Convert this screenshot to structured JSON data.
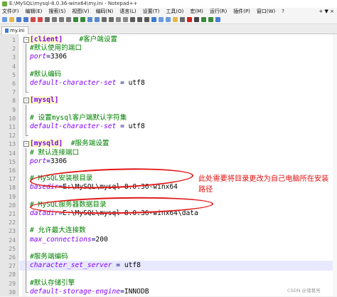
{
  "window": {
    "title": "E:\\MySQL\\mysql-8.0.36-winx64\\my.ini - Notepad++",
    "menu": [
      "文件(F)",
      "编辑(E)",
      "搜索(S)",
      "视图(V)",
      "编码(N)",
      "语言(L)",
      "设置(T)",
      "工具(O)",
      "宏(M)",
      "运行(R)",
      "插件(P)",
      "窗口(W)",
      "?"
    ],
    "menu_close": "+ ▼ ×"
  },
  "toolbar": {
    "icons": [
      "new-file-icon",
      "open-file-icon",
      "save-icon",
      "save-all-icon",
      "close-icon",
      "close-all-icon",
      "print-icon",
      "cut-icon",
      "copy-icon",
      "paste-icon",
      "undo-icon",
      "redo-icon",
      "find-icon",
      "replace-icon",
      "zoom-in-icon",
      "zoom-out-icon",
      "sync-v-icon",
      "sync-h-icon",
      "wrap-icon",
      "all-chars-icon",
      "indent-guide-icon",
      "lang-icon",
      "doc-map-icon",
      "func-list-icon",
      "folder-ws-icon",
      "monitor-icon",
      "record-icon",
      "stop-icon",
      "play-icon",
      "play-multi-icon",
      "save-macro-icon"
    ],
    "icon_colors": [
      "#6a9be0",
      "#e6b84a",
      "#4a7bd0",
      "#4a7bd0",
      "#d04a4a",
      "#d04a4a",
      "#6a6a6a",
      "#7a7a7a",
      "#7a7a7a",
      "#7a7a7a",
      "#3a8a3a",
      "#3a8a3a",
      "#5a8ad0",
      "#5a8ad0",
      "#6a6a6a",
      "#6a6a6a",
      "#8a8a8a",
      "#8a8a8a",
      "#5a5a5a",
      "#5a5a5a",
      "#5a5a5a",
      "#3a7ad1",
      "#6a9be0",
      "#6a9be0",
      "#e6b84a",
      "#6a6a6a",
      "#d02020",
      "#444444",
      "#3a8a3a",
      "#3a8a3a",
      "#4a7bd0"
    ]
  },
  "tabs": [
    {
      "label": "my.ini"
    }
  ],
  "editor": {
    "lines": [
      {
        "n": "1",
        "fold": "box-minus",
        "tokens": [
          {
            "c": "sec",
            "t": "[client]"
          },
          {
            "c": "val",
            "t": "    "
          },
          {
            "c": "cm",
            "t": "#客户端设置"
          }
        ]
      },
      {
        "n": "2",
        "fold": "bar",
        "tokens": [
          {
            "c": "cm",
            "t": "#默认使用的端口"
          }
        ]
      },
      {
        "n": "3",
        "fold": "bar",
        "tokens": [
          {
            "c": "key",
            "t": "port"
          },
          {
            "c": "op",
            "t": "="
          },
          {
            "c": "val",
            "t": "3306"
          }
        ]
      },
      {
        "n": "4",
        "fold": "bar",
        "tokens": []
      },
      {
        "n": "5",
        "fold": "bar",
        "tokens": [
          {
            "c": "cm",
            "t": "#默认编码"
          }
        ]
      },
      {
        "n": "6",
        "fold": "bar",
        "tokens": [
          {
            "c": "key",
            "t": "default-character-set"
          },
          {
            "c": "op",
            "t": " = "
          },
          {
            "c": "val",
            "t": "utf8"
          }
        ]
      },
      {
        "n": "7",
        "fold": "end",
        "tokens": []
      },
      {
        "n": "8",
        "fold": "box-minus",
        "tokens": [
          {
            "c": "sec",
            "t": "[mysql]"
          }
        ]
      },
      {
        "n": "9",
        "fold": "bar",
        "tokens": []
      },
      {
        "n": "10",
        "fold": "bar",
        "tokens": [
          {
            "c": "cm",
            "t": "# 设置mysql客户端默认字符集"
          }
        ]
      },
      {
        "n": "11",
        "fold": "bar",
        "tokens": [
          {
            "c": "key",
            "t": "default-character-set"
          },
          {
            "c": "op",
            "t": " = "
          },
          {
            "c": "val",
            "t": "utf8"
          }
        ]
      },
      {
        "n": "12",
        "fold": "end",
        "tokens": []
      },
      {
        "n": "13",
        "fold": "box-minus",
        "tokens": [
          {
            "c": "sec",
            "t": "[mysqld]"
          },
          {
            "c": "val",
            "t": "  "
          },
          {
            "c": "cm",
            "t": "#服务端设置"
          }
        ]
      },
      {
        "n": "14",
        "fold": "bar",
        "tokens": [
          {
            "c": "cm",
            "t": "# 默认连接端口"
          }
        ]
      },
      {
        "n": "15",
        "fold": "bar",
        "tokens": [
          {
            "c": "key",
            "t": "port"
          },
          {
            "c": "op",
            "t": "="
          },
          {
            "c": "val",
            "t": "3306"
          }
        ]
      },
      {
        "n": "16",
        "fold": "bar",
        "tokens": []
      },
      {
        "n": "17",
        "fold": "bar",
        "tokens": [
          {
            "c": "cm",
            "t": "# MySQL安装根目录"
          }
        ]
      },
      {
        "n": "18",
        "fold": "bar",
        "tokens": [
          {
            "c": "key",
            "t": "basedir"
          },
          {
            "c": "op",
            "t": "="
          },
          {
            "c": "val",
            "t": "E:\\MySQL\\mysql-8.0.36-winx64"
          }
        ]
      },
      {
        "n": "19",
        "fold": "bar",
        "tokens": []
      },
      {
        "n": "20",
        "fold": "bar",
        "tokens": [
          {
            "c": "cm",
            "t": "# MySQL服务器数据目录"
          }
        ]
      },
      {
        "n": "21",
        "fold": "bar",
        "tokens": [
          {
            "c": "key",
            "t": "datadir"
          },
          {
            "c": "op",
            "t": "="
          },
          {
            "c": "val",
            "t": "E:\\MySQL\\mysql-8.0.36-winx64\\data"
          }
        ]
      },
      {
        "n": "22",
        "fold": "bar",
        "tokens": []
      },
      {
        "n": "23",
        "fold": "bar",
        "tokens": [
          {
            "c": "cm",
            "t": "# 允许最大连接数"
          }
        ]
      },
      {
        "n": "24",
        "fold": "bar",
        "tokens": [
          {
            "c": "key",
            "t": "max_connections"
          },
          {
            "c": "op",
            "t": "="
          },
          {
            "c": "val",
            "t": "200"
          }
        ]
      },
      {
        "n": "25",
        "fold": "bar",
        "tokens": []
      },
      {
        "n": "26",
        "fold": "bar",
        "tokens": [
          {
            "c": "cm",
            "t": "#服务端编码"
          }
        ]
      },
      {
        "n": "27",
        "fold": "bar",
        "highlight": true,
        "tokens": [
          {
            "c": "key",
            "t": "character_set_server"
          },
          {
            "c": "op",
            "t": " = "
          },
          {
            "c": "val",
            "t": "utf8"
          }
        ]
      },
      {
        "n": "28",
        "fold": "bar",
        "tokens": []
      },
      {
        "n": "29",
        "fold": "bar",
        "tokens": [
          {
            "c": "cm",
            "t": "#默认存储引擎"
          }
        ]
      },
      {
        "n": "30",
        "fold": "end",
        "tokens": [
          {
            "c": "key",
            "t": "default-storage-engine"
          },
          {
            "c": "op",
            "t": "="
          },
          {
            "c": "val",
            "t": "INNODB"
          }
        ]
      }
    ]
  },
  "annotation": {
    "text": "此处需要将目录更改为自己电脑所在安装路径",
    "color": "#e01010"
  },
  "watermark": "CSDN @诸葛亮"
}
